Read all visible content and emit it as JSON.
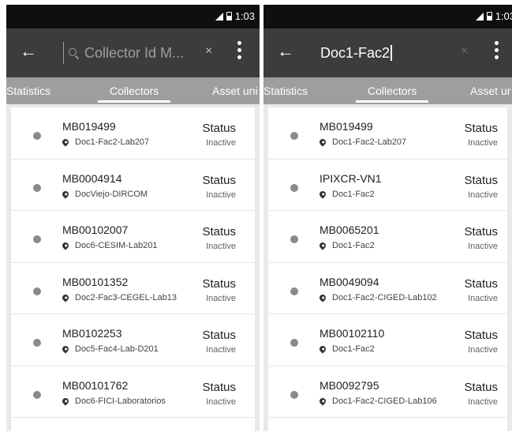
{
  "status_bar": {
    "time": "1:03"
  },
  "left_screen": {
    "search": {
      "placeholder": "Collector Id M..."
    },
    "clear_label": "×",
    "tabs": [
      {
        "label": "Statistics"
      },
      {
        "label": "Collectors"
      },
      {
        "label": "Asset uni"
      }
    ],
    "collectors": [
      {
        "id": "MB019499",
        "location": "Doc1-Fac2-Lab207",
        "status_label": "Status",
        "status": "Inactive"
      },
      {
        "id": "MB0004914",
        "location": "DocViejo-DIRCOM",
        "status_label": "Status",
        "status": "Inactive"
      },
      {
        "id": "MB00102007",
        "location": "Doc6-CESIM-Lab201",
        "status_label": "Status",
        "status": "Inactive"
      },
      {
        "id": "MB00101352",
        "location": "Doc2-Fac3-CEGEL-Lab13",
        "status_label": "Status",
        "status": "Inactive"
      },
      {
        "id": "MB0102253",
        "location": "Doc5-Fac4-Lab-D201",
        "status_label": "Status",
        "status": "Inactive"
      },
      {
        "id": "MB00101762",
        "location": "Doc6-FICI-Laboratorios",
        "status_label": "Status",
        "status": "Inactive"
      }
    ]
  },
  "right_screen": {
    "search": {
      "value": "Doc1-Fac2"
    },
    "clear_label": "×",
    "tabs": [
      {
        "label": "Statistics"
      },
      {
        "label": "Collectors"
      },
      {
        "label": "Asset ur"
      }
    ],
    "collectors": [
      {
        "id": "MB019499",
        "location": "Doc1-Fac2-Lab207",
        "status_label": "Status",
        "status": "Inactive"
      },
      {
        "id": "IPIXCR-VN1",
        "location": "Doc1-Fac2",
        "status_label": "Status",
        "status": "Inactive"
      },
      {
        "id": "MB0065201",
        "location": "Doc1-Fac2",
        "status_label": "Status",
        "status": "Inactive"
      },
      {
        "id": "MB0049094",
        "location": "Doc1-Fac2-CIGED-Lab102",
        "status_label": "Status",
        "status": "Inactive"
      },
      {
        "id": "MB00102110",
        "location": "Doc1-Fac2",
        "status_label": "Status",
        "status": "Inactive"
      },
      {
        "id": "MB0092795",
        "location": "Doc1-Fac2-CIGED-Lab106",
        "status_label": "Status",
        "status": "Inactive"
      }
    ]
  }
}
